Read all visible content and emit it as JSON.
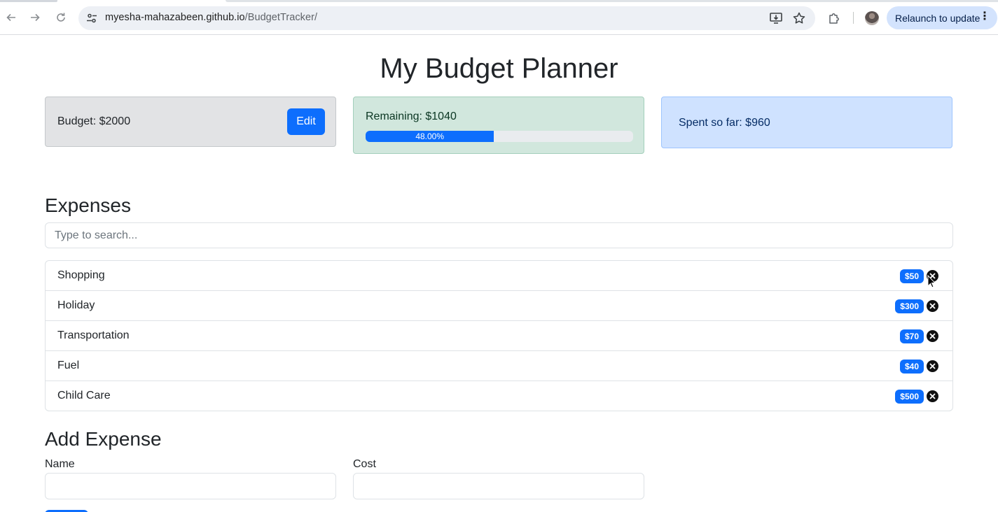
{
  "browser": {
    "url_host": "myesha-mahazabeen.github.io",
    "url_path": "/BudgetTracker/",
    "relaunch_label": "Relaunch to update"
  },
  "page": {
    "title": "My Budget Planner"
  },
  "summary": {
    "budget_text": "Budget: $2000",
    "edit_label": "Edit",
    "remaining_text": "Remaining: $1040",
    "progress_label": "48.00%",
    "progress_fraction": 0.48,
    "spent_text": "Spent so far: $960"
  },
  "expenses": {
    "heading": "Expenses",
    "search_placeholder": "Type to search...",
    "items": [
      {
        "name": "Shopping",
        "cost": "$50"
      },
      {
        "name": "Holiday",
        "cost": "$300"
      },
      {
        "name": "Transportation",
        "cost": "$70"
      },
      {
        "name": "Fuel",
        "cost": "$40"
      },
      {
        "name": "Child Care",
        "cost": "$500"
      }
    ]
  },
  "add_expense": {
    "heading": "Add Expense",
    "name_label": "Name",
    "cost_label": "Cost"
  },
  "colors": {
    "primary": "#0d6efd",
    "budget_bg": "#e2e3e5",
    "remaining_bg": "#d1e7dd",
    "spent_bg": "#cfe2ff"
  },
  "icons": {
    "back": "arrow-left-icon",
    "forward": "arrow-right-icon",
    "reload": "reload-icon",
    "site_info": "site-settings-icon",
    "install": "install-app-icon",
    "bookmark": "star-icon",
    "extensions": "puzzle-icon",
    "delete": "close-circle-icon"
  }
}
